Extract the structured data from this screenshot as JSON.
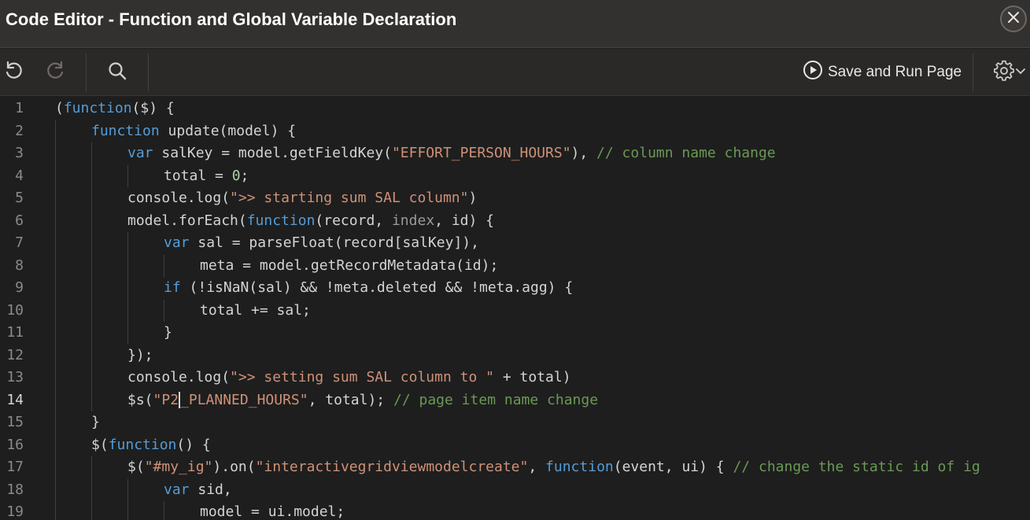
{
  "window": {
    "title": "Code Editor - Function and Global Variable Declaration",
    "close_label": "close"
  },
  "toolbar": {
    "undo_icon": "undo-icon",
    "redo_icon": "redo-icon",
    "search_icon": "search-icon",
    "run_label": "Save and Run Page",
    "run_icon": "play-circle-icon",
    "settings_icon": "gear-icon"
  },
  "colors": {
    "keyword": "#569cd6",
    "string": "#ce9178",
    "comment": "#6a9955",
    "number": "#b5cea8",
    "text": "#d4d4d4",
    "background": "#1e1e1e"
  },
  "editor": {
    "current_line": 14,
    "lines": [
      {
        "n": "1",
        "indent": 0,
        "tokens": [
          [
            "t",
            "("
          ],
          [
            "kw",
            "function"
          ],
          [
            "t",
            "($) {"
          ]
        ]
      },
      {
        "n": "2",
        "indent": 1,
        "tokens": [
          [
            "kw",
            "function"
          ],
          [
            "t",
            " update(model) {"
          ]
        ]
      },
      {
        "n": "3",
        "indent": 2,
        "tokens": [
          [
            "kw",
            "var"
          ],
          [
            "t",
            " salKey = model.getFieldKey("
          ],
          [
            "str",
            "\"EFFORT_PERSON_HOURS\""
          ],
          [
            "t",
            "), "
          ],
          [
            "cm",
            "// column name change"
          ]
        ]
      },
      {
        "n": "4",
        "indent": 3,
        "tokens": [
          [
            "t",
            "total = "
          ],
          [
            "num",
            "0"
          ],
          [
            "t",
            ";"
          ]
        ]
      },
      {
        "n": "5",
        "indent": 2,
        "tokens": [
          [
            "t",
            "console.log("
          ],
          [
            "str",
            "\">> starting sum SAL column\""
          ],
          [
            "t",
            ")"
          ]
        ]
      },
      {
        "n": "6",
        "indent": 2,
        "tokens": [
          [
            "t",
            "model.forEach("
          ],
          [
            "kw",
            "function"
          ],
          [
            "t",
            "(record, "
          ],
          [
            "dim",
            "index"
          ],
          [
            "t",
            ", id) {"
          ]
        ]
      },
      {
        "n": "7",
        "indent": 3,
        "tokens": [
          [
            "kw",
            "var"
          ],
          [
            "t",
            " sal = parseFloat(record[salKey]),"
          ]
        ]
      },
      {
        "n": "8",
        "indent": 4,
        "tokens": [
          [
            "t",
            "meta = model.getRecordMetadata(id);"
          ]
        ]
      },
      {
        "n": "9",
        "indent": 3,
        "tokens": [
          [
            "kw",
            "if"
          ],
          [
            "t",
            " (!isNaN(sal) && !meta.deleted && !meta.agg) {"
          ]
        ]
      },
      {
        "n": "10",
        "indent": 4,
        "tokens": [
          [
            "t",
            "total += sal;"
          ]
        ]
      },
      {
        "n": "11",
        "indent": 3,
        "tokens": [
          [
            "t",
            "}"
          ]
        ]
      },
      {
        "n": "12",
        "indent": 2,
        "tokens": [
          [
            "t",
            "});"
          ]
        ]
      },
      {
        "n": "13",
        "indent": 2,
        "tokens": [
          [
            "t",
            "console.log("
          ],
          [
            "str",
            "\">> setting sum SAL column to \""
          ],
          [
            "t",
            " + total)"
          ]
        ]
      },
      {
        "n": "14",
        "indent": 2,
        "tokens": [
          [
            "t",
            "$s("
          ],
          [
            "str",
            "\"P2"
          ],
          [
            "cur",
            ""
          ],
          [
            "str",
            "_PLANNED_HOURS\""
          ],
          [
            "t",
            ", total"
          ],
          [
            "t",
            ")"
          ],
          [
            "t",
            "; "
          ],
          [
            "cm",
            "// page item name change"
          ]
        ]
      },
      {
        "n": "15",
        "indent": 1,
        "tokens": [
          [
            "t",
            "}"
          ]
        ]
      },
      {
        "n": "16",
        "indent": 1,
        "tokens": [
          [
            "t",
            "$("
          ],
          [
            "kw",
            "function"
          ],
          [
            "t",
            "() {"
          ]
        ]
      },
      {
        "n": "17",
        "indent": 2,
        "tokens": [
          [
            "t",
            "$("
          ],
          [
            "str",
            "\"#my_ig\""
          ],
          [
            "t",
            ").on("
          ],
          [
            "str",
            "\"interactivegridviewmodelcreate\""
          ],
          [
            "t",
            ", "
          ],
          [
            "kw",
            "function"
          ],
          [
            "t",
            "(event, ui) { "
          ],
          [
            "cm",
            "// change the static id of ig"
          ]
        ]
      },
      {
        "n": "18",
        "indent": 3,
        "tokens": [
          [
            "kw",
            "var"
          ],
          [
            "t",
            " sid,"
          ]
        ]
      },
      {
        "n": "19",
        "indent": 4,
        "tokens": [
          [
            "t",
            "model = ui.model;"
          ]
        ]
      }
    ]
  }
}
